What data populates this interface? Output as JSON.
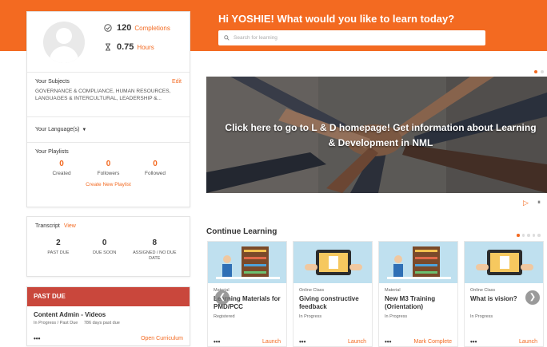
{
  "header": {
    "greeting": "Hi YOSHIE! What would you like to learn today?",
    "search_placeholder": "Search for learning"
  },
  "profile": {
    "completions_value": "120",
    "completions_label": "Completions",
    "hours_value": "0.75",
    "hours_label": "Hours"
  },
  "subjects": {
    "title": "Your Subjects",
    "edit": "Edit",
    "text": "GOVERNANCE & COMPLIANCE, HUMAN RESOURCES, LANGUAGES & INTERCULTURAL, LEADERSHIP &..."
  },
  "languages": {
    "title": "Your Language(s)"
  },
  "playlists": {
    "title": "Your Playlists",
    "created_value": "0",
    "created_label": "Created",
    "followers_value": "0",
    "followers_label": "Followers",
    "followed_value": "0",
    "followed_label": "Followed",
    "create_link": "Create New Playlist"
  },
  "transcript": {
    "title": "Transcript",
    "view": "View",
    "past_due_value": "2",
    "past_due_label": "PAST DUE",
    "due_soon_value": "0",
    "due_soon_label": "DUE SOON",
    "assigned_value": "8",
    "assigned_label": "ASSIGNED / NO DUE DATE"
  },
  "past_due": {
    "header": "PAST DUE",
    "title": "Content Admin - Videos",
    "status": "In Progress / Past Due",
    "days": "786 days past due",
    "dots": "•••",
    "action": "Open Curriculum"
  },
  "banner": {
    "text": "Click here to go to L & D homepage! Get information about Learning & Development in NML"
  },
  "continue_learning": {
    "title": "Continue Learning",
    "courses": [
      {
        "type": "Material",
        "name": "Learning Materials for PMD/PCC",
        "status": "Registered",
        "dots": "•••",
        "action": "Launch"
      },
      {
        "type": "Online Class",
        "name": "Giving constructive feedback",
        "status": "In Progress",
        "dots": "•••",
        "action": "Launch"
      },
      {
        "type": "Material",
        "name": "New M3 Training (Orientation)",
        "status": "In Progress",
        "dots": "•••",
        "action": "Mark Complete"
      },
      {
        "type": "Online Class",
        "name": "What is vision?",
        "status": "In Progress",
        "dots": "•••",
        "action": "Launch"
      }
    ]
  },
  "colors": {
    "accent": "#f36a21",
    "past_due_header": "#c9473c"
  },
  "icons": {
    "completions": "check-circle-icon",
    "hours": "hourglass-icon",
    "search": "search-icon"
  }
}
